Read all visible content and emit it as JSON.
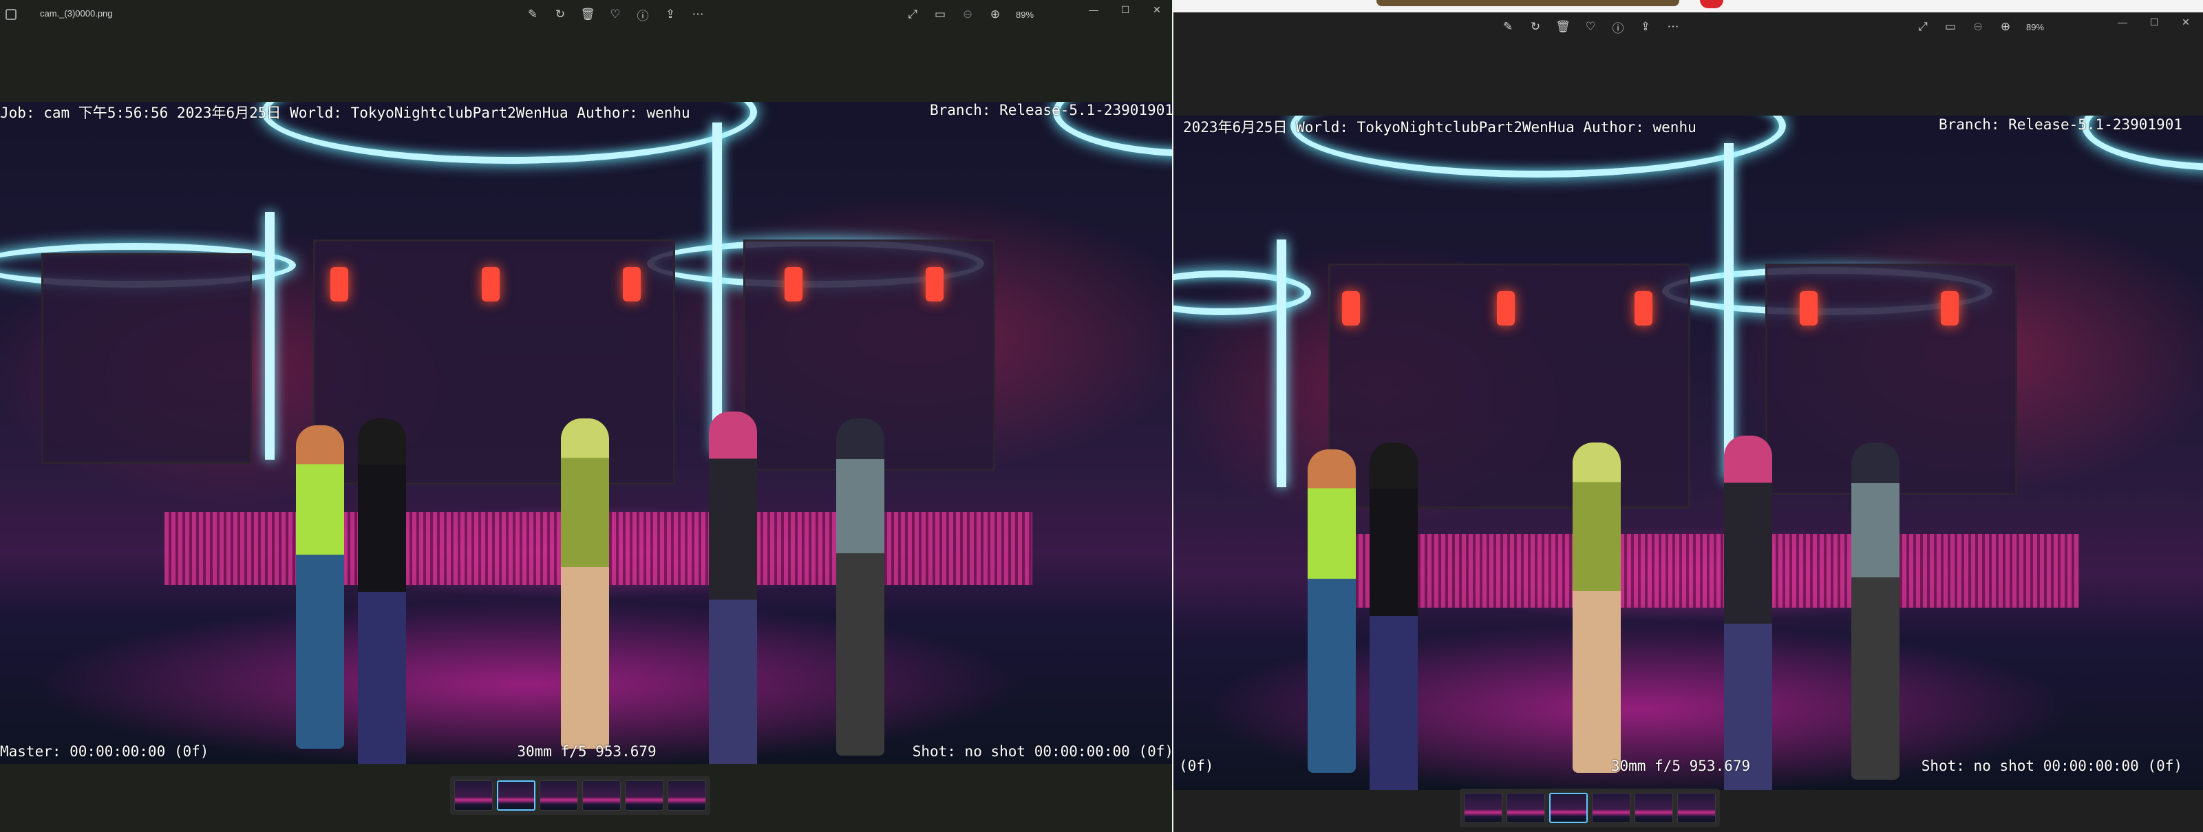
{
  "left_window": {
    "filename": "cam._(3)0000.png",
    "zoom": "89%",
    "toolbar_icons": [
      "edit-icon",
      "rotate-icon",
      "delete-icon",
      "heart-icon",
      "info-icon",
      "share-icon",
      "more-icon"
    ],
    "view_icons": [
      "fullscreen-icon",
      "filmstrip-icon",
      "zoom-out-icon",
      "zoom-in-icon"
    ],
    "overlay": {
      "top_left": "Job: cam 下午5:56:56 2023年6月25日 World: TokyoNightclubPart2WenHua Author: wenhu",
      "top_right": "Branch: Release-5.1-23901901",
      "bottom_left": "Master: 00:00:00:00 (0f)",
      "bottom_center": "30mm f/5 953.679",
      "bottom_right": "Shot: no shot 00:00:00:00 (0f)"
    },
    "thumbnail_count": 6,
    "selected_thumbnail": 2
  },
  "right_window": {
    "zoom": "89%",
    "overlay": {
      "top_left": "2023年6月25日 World: TokyoNightclubPart2WenHua Author: wenhu",
      "top_right": "Branch: Release-5.1-23901901",
      "bottom_left": "(0f)",
      "bottom_center": "30mm f/5 953.679",
      "bottom_right": "Shot: no shot 00:00:00:00 (0f)"
    },
    "thumbnail_count": 6,
    "selected_thumbnail": 3
  },
  "glyphs": {
    "edit": "✎",
    "rotate": "↻",
    "delete": "🗑",
    "heart": "♡",
    "info": "ⓘ",
    "share": "⇪",
    "more": "⋯",
    "fullscreen": "⤢",
    "filmstrip": "▭",
    "zoom_out": "⊖",
    "zoom_in": "⊕",
    "minimize": "—",
    "maximize": "☐",
    "close": "✕"
  },
  "colors": {
    "accent": "#5fc9ff",
    "neon": "#bff5ff",
    "pink": "#d1308f"
  }
}
